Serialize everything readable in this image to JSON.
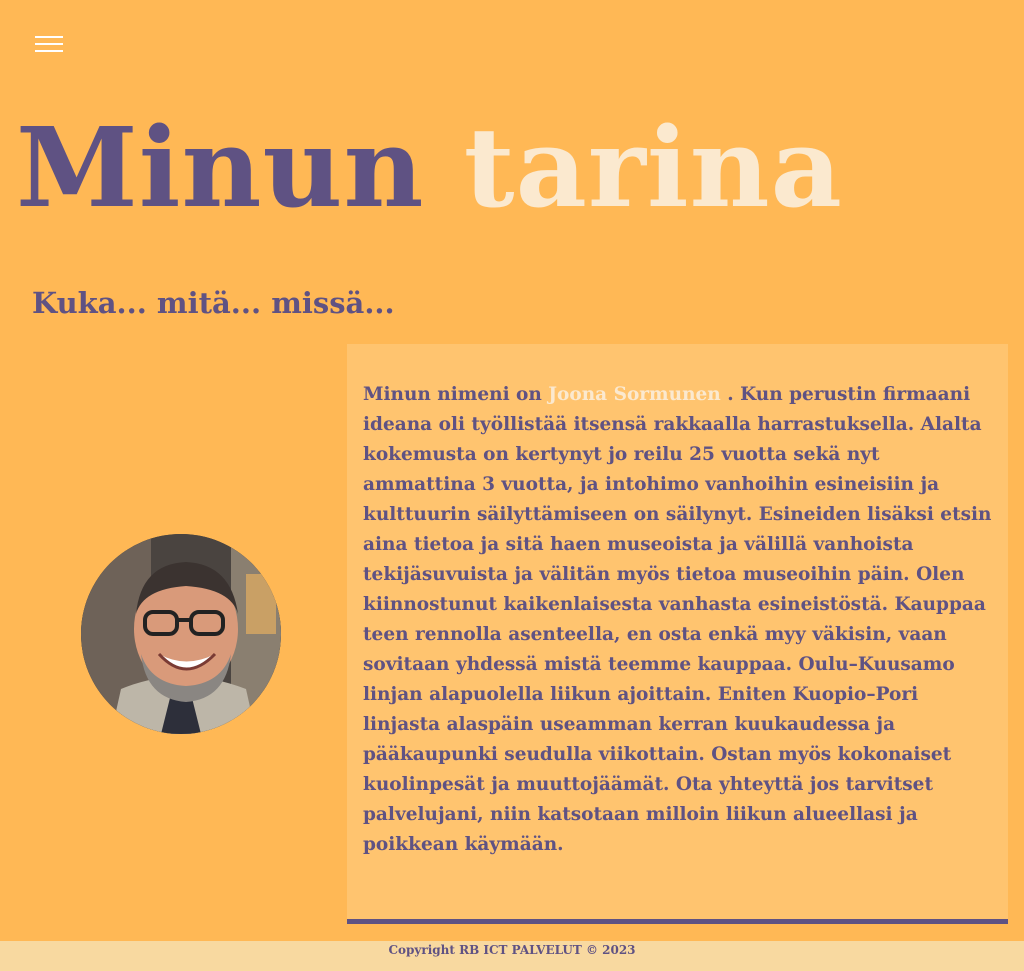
{
  "header": {
    "menu_icon": "hamburger-menu-icon"
  },
  "hero": {
    "title_part_1": "Minun",
    "title_part_2": "tarina",
    "subtitle": "Kuka... mitä... missä..."
  },
  "profile": {
    "avatar_alt": "Smiling man with glasses and grey beard"
  },
  "bio": {
    "intro": "Minun nimeni on",
    "name_link": "Joona Sormunen",
    "text": ". Kun perustin firmaani ideana oli työllistää itsensä rakkaalla harrastuksella. Alalta kokemusta on kertynyt jo reilu 25 vuotta sekä nyt ammattina 3 vuotta, ja intohimo vanhoihin esineisiin ja kulttuurin säilyttämiseen on säilynyt. Esineiden lisäksi etsin aina tietoa ja sitä haen museoista ja välillä vanhoista tekijäsuvuista ja välitän myös tietoa museoihin päin. Olen kiinnostunut kaikenlaisesta vanhasta esineistöstä. Kauppaa teen rennolla asenteella, en osta enkä myy väkisin, vaan sovitaan yhdessä mistä teemme kauppaa. Oulu–Kuusamo linjan alapuolella liikun ajoittain. Eniten Kuopio–Pori linjasta alaspäin useamman kerran kuukaudessa ja pääkaupunki seudulla viikottain. Ostan myös kokonaiset kuolinpesät ja muuttojäämät. Ota yhteyttä jos tarvitset palvelujani, niin katsotaan milloin liikun alueellasi ja poikkean käymään."
  },
  "footer": {
    "copyright": "Copyright RB ICT PALVELUT © 2023"
  },
  "colors": {
    "background": "#ffb855",
    "card": "#ffc46f",
    "accent_purple": "#5f5283",
    "accent_cream": "#fbe9cf",
    "footer_bg": "#f8d9a0"
  }
}
